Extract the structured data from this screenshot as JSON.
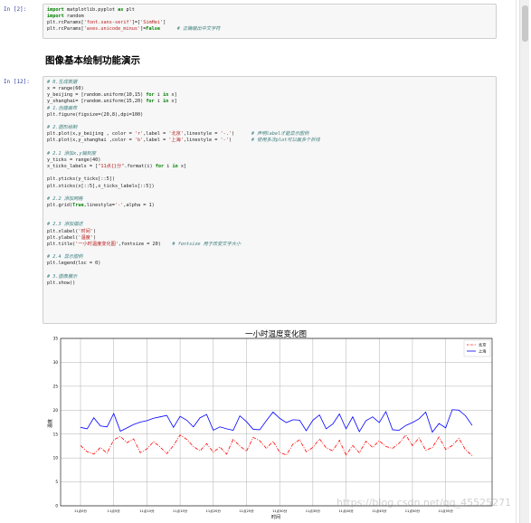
{
  "cell1": {
    "prompt": "In  [2]:",
    "lines": [
      "import matplotlib.pyplot as plt",
      "import random",
      "plt.rcParams['font.sans-serif']=['SimHei']",
      "plt.rcParams['axes.unicode_minus']=False      # 正确输出中文字符"
    ]
  },
  "heading": "图像基本绘制功能演示",
  "cell2": {
    "prompt": "In  [12]:",
    "lines": [
      "# 0.生成数据",
      "x = range(60)",
      "y_beijing = [random.uniform(10,15) for i in x]",
      "y_shanghai= [random.uniform(15,20) for i in x]",
      "# 1.创建画布",
      "plt.figure(figsize=(20,8),dpi=100)",
      "",
      "# 2.图形绘制",
      "plt.plot(x,y_beijing , color = 'r',label = '北京',linestyle = '-.')      # 声明label才能显示图例",
      "plt.plot(x,y_shanghai ,color = 'b',label = '上海',linestyle = '-')       # 使用多次plot可以画多个折线",
      "",
      "# 2.1 添加x,y轴刻度",
      "y_ticks = range(40)",
      "x_ticks_labels = [\"11点{}分\".format(i) for i in x]",
      "",
      "plt.yticks(y_ticks[::5])",
      "plt.xticks(x[::5],x_ticks_labels[::5])",
      "",
      "# 2.2 添加网格",
      "plt.grid(True,linestyle='-',alpha = 1)",
      "",
      "",
      "# 2.3 添加描述",
      "plt.xlabel('时间')",
      "plt.ylabel('温度')",
      "plt.title('一小时温度变化图',fontsize = 20)    # fontsize 用于改变文字大小",
      "",
      "# 2.4 显示图例",
      "plt.legend(loc = 0)",
      "",
      "# 3.图像展示",
      "plt.show()"
    ]
  },
  "watermark": "https://blog.csdn.net/qq_45525271",
  "chart_data": {
    "type": "line",
    "title": "一小时温度变化图",
    "xlabel": "时间",
    "ylabel": "温度",
    "ylim": [
      0,
      35
    ],
    "yticks": [
      0,
      5,
      10,
      15,
      20,
      25,
      30,
      35
    ],
    "xlim": [
      -3,
      62
    ],
    "xtick_positions": [
      0,
      5,
      10,
      15,
      20,
      25,
      30,
      35,
      40,
      45,
      50,
      55
    ],
    "xtick_labels": [
      "11点0分",
      "11点5分",
      "11点10分",
      "11点15分",
      "11点20分",
      "11点25分",
      "11点30分",
      "11点35分",
      "11点40分",
      "11点45分",
      "11点50分",
      "11点55分"
    ],
    "grid": true,
    "legend_loc": "top-right",
    "x": [
      0,
      1,
      2,
      3,
      4,
      5,
      6,
      7,
      8,
      9,
      10,
      11,
      12,
      13,
      14,
      15,
      16,
      17,
      18,
      19,
      20,
      21,
      22,
      23,
      24,
      25,
      26,
      27,
      28,
      29,
      30,
      31,
      32,
      33,
      34,
      35,
      36,
      37,
      38,
      39,
      40,
      41,
      42,
      43,
      44,
      45,
      46,
      47,
      48,
      49,
      50,
      51,
      52,
      53,
      54,
      55,
      56,
      57,
      58,
      59
    ],
    "series": [
      {
        "name": "北京",
        "color": "#ff0000",
        "style": "dashdot",
        "values": [
          12.6,
          11.3,
          10.8,
          12.2,
          11.0,
          13.8,
          14.5,
          13.2,
          14.0,
          11.1,
          11.9,
          13.4,
          12.3,
          10.9,
          12.6,
          14.8,
          13.9,
          12.4,
          11.5,
          13.0,
          11.2,
          12.3,
          10.8,
          13.9,
          12.5,
          11.4,
          14.3,
          13.6,
          12.0,
          13.5,
          11.2,
          10.6,
          12.9,
          13.8,
          11.3,
          12.2,
          14.0,
          12.1,
          11.5,
          13.7,
          10.6,
          12.6,
          11.1,
          13.5,
          12.2,
          13.6,
          12.4,
          12.0,
          13.1,
          14.8,
          12.6,
          14.2,
          11.6,
          12.2,
          14.4,
          11.8,
          12.6,
          14.1,
          11.7,
          10.5
        ]
      },
      {
        "name": "上海",
        "color": "#0000ff",
        "style": "solid",
        "values": [
          16.4,
          16.1,
          18.4,
          16.7,
          16.5,
          19.3,
          15.6,
          16.3,
          17.0,
          17.5,
          17.8,
          18.3,
          18.6,
          18.9,
          16.4,
          18.7,
          17.9,
          16.5,
          18.4,
          19.1,
          15.8,
          16.5,
          16.1,
          15.8,
          18.8,
          17.6,
          16.0,
          15.9,
          17.8,
          19.6,
          18.3,
          17.4,
          18.0,
          17.9,
          15.7,
          17.9,
          19.0,
          16.1,
          17.1,
          19.2,
          16.1,
          18.6,
          15.5,
          17.8,
          18.6,
          17.4,
          19.7,
          15.9,
          15.8,
          16.8,
          17.4,
          18.2,
          19.6,
          15.4,
          17.2,
          16.3,
          20.1,
          20.0,
          18.8,
          16.8
        ]
      }
    ]
  }
}
